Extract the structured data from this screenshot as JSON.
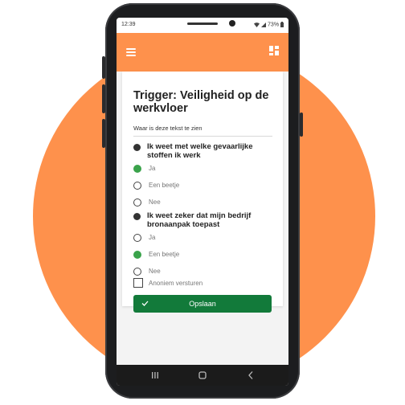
{
  "statusbar": {
    "time": "12:39",
    "battery": "73%",
    "icons": [
      "wifi-icon",
      "signal-icon",
      "battery-icon"
    ]
  },
  "appbar": {
    "color": "#FE914C",
    "left_icon": "menu-icon",
    "right_icon": "grid-icon"
  },
  "form": {
    "title": "Trigger: Veiligheid op de werkvloer",
    "subtitle": "Waar is deze tekst te zien",
    "questions": [
      {
        "text": "Ik weet met welke gevaarlijke stoffen ik werk",
        "options": [
          {
            "label": "Ja",
            "selected": true
          },
          {
            "label": "Een beetje",
            "selected": false
          },
          {
            "label": "Nee",
            "selected": false
          }
        ]
      },
      {
        "text": "Ik weet zeker dat mijn bedrijf bronaanpak toepast",
        "options": [
          {
            "label": "Ja",
            "selected": false
          },
          {
            "label": "Een beetje",
            "selected": true
          },
          {
            "label": "Nee",
            "selected": false
          }
        ]
      }
    ],
    "anonymous_label": "Anoniem versturen",
    "anonymous_checked": false,
    "save_label": "Opslaan",
    "save_color": "#127a3a",
    "selected_color": "#3aa34b"
  },
  "background_circle_color": "#FE914C"
}
